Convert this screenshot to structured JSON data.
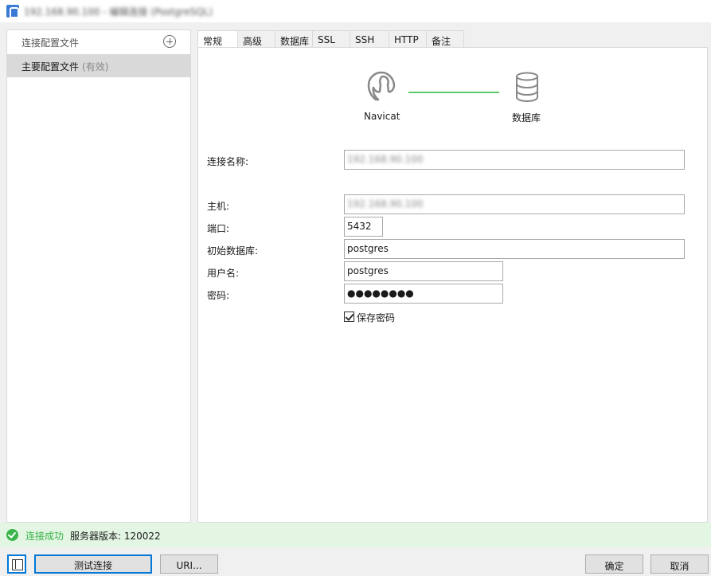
{
  "window": {
    "title": "192.168.90.100 - 编辑连接 (PostgreSQL)"
  },
  "sidebar": {
    "header_label": "连接配置文件",
    "items": [
      {
        "label": "主要配置文件",
        "status": "(有效)"
      }
    ]
  },
  "tabs": [
    {
      "label": "常规"
    },
    {
      "label": "高级"
    },
    {
      "label": "数据库"
    },
    {
      "label": "SSL"
    },
    {
      "label": "SSH"
    },
    {
      "label": "HTTP"
    },
    {
      "label": "备注"
    }
  ],
  "diagram": {
    "left_label": "Navicat",
    "right_label": "数据库"
  },
  "form": {
    "connection_name": {
      "label": "连接名称:",
      "value": "192.168.90.100"
    },
    "host": {
      "label": "主机:",
      "value": "192.168.90.100"
    },
    "port": {
      "label": "端口:",
      "value": "5432"
    },
    "initial_db": {
      "label": "初始数据库:",
      "value": "postgres"
    },
    "username": {
      "label": "用户名:",
      "value": "postgres"
    },
    "password": {
      "label": "密码:",
      "value": "●●●●●●●●"
    },
    "save_password": {
      "label": "保存密码",
      "checked": true
    }
  },
  "status": {
    "message": "连接成功",
    "server_version": "服务器版本: 120022"
  },
  "buttons": {
    "test": "测试连接",
    "uri": "URI...",
    "ok": "确定",
    "cancel": "取消"
  },
  "colors": {
    "accent": "#0078d7",
    "success": "#3ab549",
    "link_line": "#5cc96b"
  }
}
